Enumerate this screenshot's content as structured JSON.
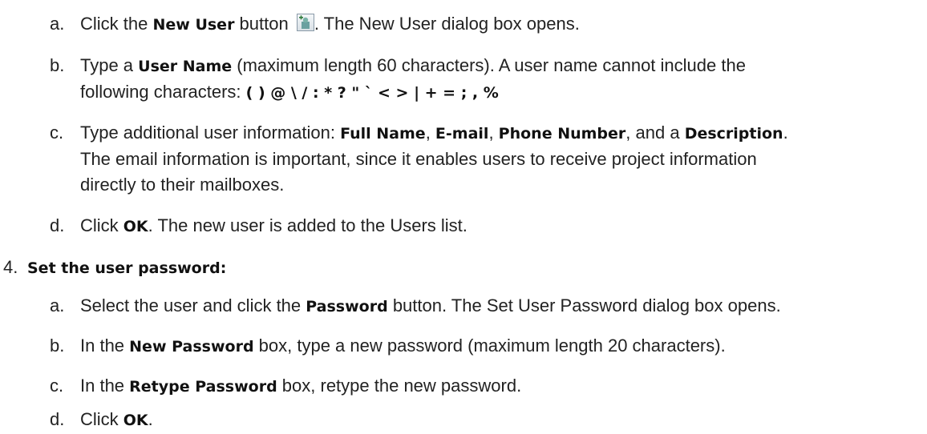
{
  "step3": {
    "a": {
      "marker": "a.",
      "pre": "Click the ",
      "bold": "New User",
      "mid": " button ",
      "icon": "new-user-icon",
      "post": ". The New User dialog box opens."
    },
    "b": {
      "marker": "b.",
      "pre": "Type a ",
      "bold": "User Name",
      "post": " (maximum length 60 characters). A user name cannot include the",
      "line2_pre": "following characters: ",
      "line2_bold": "( ) @ \\ / : * ? \" ` < > | + = ; , %"
    },
    "c": {
      "marker": "c.",
      "pre": "Type additional user information: ",
      "bold1": "Full Name",
      "sep1": ", ",
      "bold2": "E-mail",
      "sep2": ", ",
      "bold3": "Phone Number",
      "sep3": ", and a ",
      "bold4": "Description",
      "end": ".",
      "line2": "The email information is important, since it enables users to receive project information",
      "line3": "directly to their mailboxes."
    },
    "d": {
      "marker": "d.",
      "pre": "Click ",
      "bold": "OK",
      "post": ". The new user is added to the Users list."
    }
  },
  "step4": {
    "number": "4.",
    "title": "Set the user password:",
    "a": {
      "marker": "a.",
      "pre": "Select the user and click the ",
      "bold": "Password",
      "post": " button. The Set User Password dialog box opens."
    },
    "b": {
      "marker": "b.",
      "pre": "In the ",
      "bold": "New Password",
      "post": " box, type a new password (maximum length 20 characters)."
    },
    "c": {
      "marker": "c.",
      "pre": "In the ",
      "bold": "Retype Password",
      "post": " box, retype the new password."
    },
    "d": {
      "marker": "d.",
      "pre": "Click ",
      "bold": "OK",
      "post": "."
    }
  }
}
